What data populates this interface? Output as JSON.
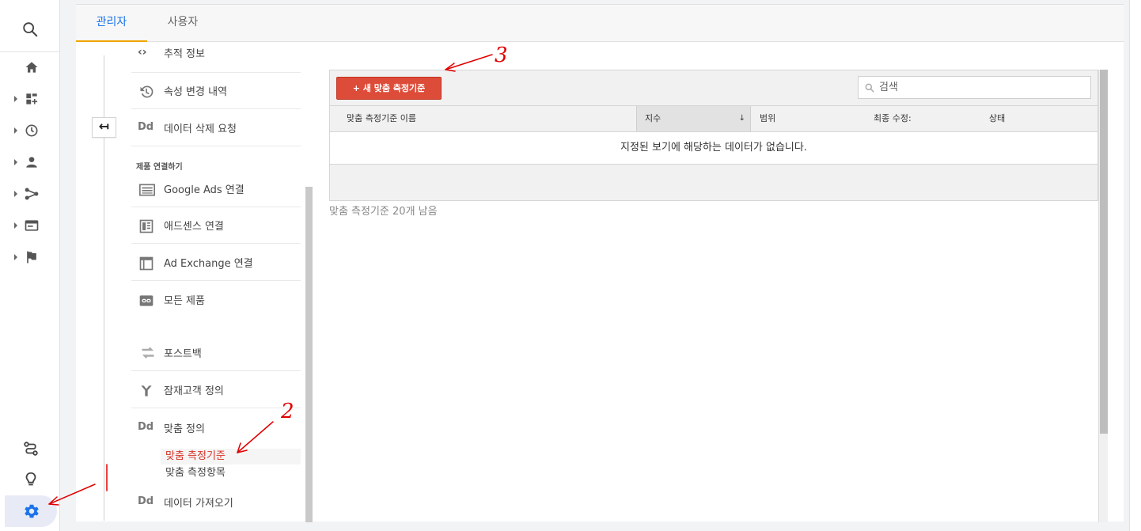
{
  "tabs": [
    {
      "label": "관리자",
      "active": true
    },
    {
      "label": "사용자",
      "active": false
    }
  ],
  "rail": {
    "top_icons": [
      "search-icon"
    ],
    "items": [
      "home-icon",
      "dashboard-icon",
      "clock-icon",
      "person-icon",
      "acquisition-icon",
      "behavior-icon",
      "flag-icon"
    ],
    "bottom_icons": [
      "route-icon",
      "lightbulb-icon",
      "gear-icon"
    ]
  },
  "nav": {
    "items_top": [
      {
        "label": "추적 정보",
        "icon": "code-brackets-icon"
      },
      {
        "label": "속성 변경 내역",
        "icon": "history-icon"
      },
      {
        "label": "데이터 삭제 요청",
        "icon": "dd-icon",
        "icon_text": "Dd"
      }
    ],
    "section_label": "제품 연결하기",
    "items_products": [
      {
        "label": "Google Ads 연결",
        "icon": "ads-icon"
      },
      {
        "label": "애드센스 연결",
        "icon": "adsense-icon"
      },
      {
        "label": "Ad Exchange 연결",
        "icon": "adexchange-icon"
      },
      {
        "label": "모든 제품",
        "icon": "link-icon"
      }
    ],
    "items_bottom": [
      {
        "label": "포스트백",
        "icon": "postback-icon"
      },
      {
        "label": "잠재고객 정의",
        "icon": "audience-icon"
      },
      {
        "label": "맞춤 정의",
        "icon": "dd-icon",
        "icon_text": "Dd"
      }
    ],
    "sub_items": [
      {
        "label": "맞춤 측정기준",
        "active": true
      },
      {
        "label": "맞춤 측정항목",
        "active": false
      }
    ],
    "last_item": {
      "label": "데이터 가져오기",
      "icon": "dd-icon",
      "icon_text": "Dd"
    }
  },
  "content": {
    "new_button_label": "+ 새 맞춤 측정기준",
    "search_placeholder": "검색",
    "columns": [
      "맞춤 측정기준 이름",
      "지수",
      "범위",
      "최종 수정:",
      "상태"
    ],
    "sorted_column": "지수",
    "sort_arrow": "↓",
    "empty_message": "지정된 보기에 해당하는 데이터가 없습니다.",
    "remaining": "맞춤 측정기준 20개 남음"
  },
  "annotations": {
    "label_1": "1",
    "label_2": "2",
    "label_3": "3"
  },
  "colors": {
    "accent_blue": "#1a73e8",
    "tab_underline": "#f0a500",
    "primary_button": "#dd4b39",
    "annotation_red": "#e00000"
  }
}
